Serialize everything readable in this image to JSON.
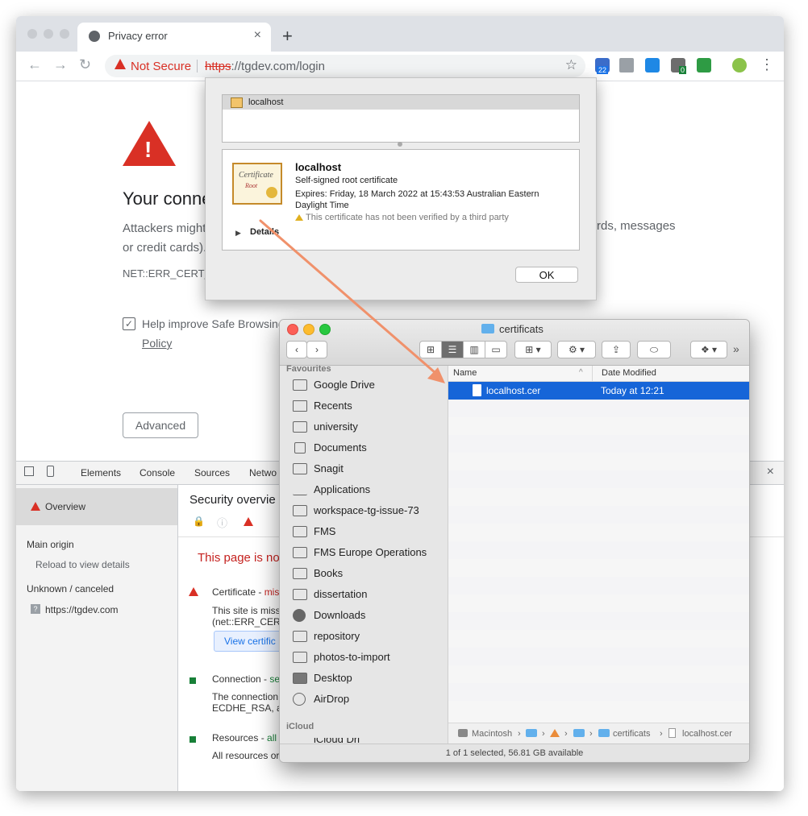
{
  "browser": {
    "tab_title": "Privacy error",
    "tab_close": "×",
    "new_tab": "+",
    "nav_back": "←",
    "nav_forward": "→",
    "nav_reload": "↻",
    "security_label": "Not Secure",
    "url_scheme": "https",
    "url_rest": "://tgdev.com/login",
    "bookmark": "☆",
    "ext_badges": [
      "22",
      "0"
    ],
    "menu": "⋮",
    "icons": [
      "globe-icon",
      "warning-icon",
      "star-icon",
      "extension-icons",
      "profile-icon",
      "kebab-menu-icon"
    ]
  },
  "interstitial": {
    "heading": "Your conne",
    "body_line1": "Attackers might",
    "body_line1_tail": "rds, messages",
    "body_line2": "or credit cards).",
    "error_code": "NET::ERR_CERT_",
    "checkbox_checked": "✓",
    "safe_browsing": "Help improve Safe Browsing",
    "policy": "Policy",
    "advanced": "Advanced"
  },
  "devtools": {
    "tabs": [
      "Elements",
      "Console",
      "Sources",
      "Netwo"
    ],
    "close": "×",
    "sidebar": {
      "overview": "Overview",
      "main_origin": "Main origin",
      "reload": "Reload to view details",
      "unknown": "Unknown / canceled",
      "origin_badge": "?",
      "origin": "https://tgdev.com"
    },
    "main": {
      "title": "Security overvie",
      "lock": "🔒",
      "info": "ⓘ",
      "page_status": "This page is no",
      "cert_label": "Certificate - ",
      "cert_status": "mis",
      "cert_desc1": "This site is miss",
      "cert_desc2": "(net::ERR_CERT",
      "view_cert": "View certific",
      "conn_label": "Connection - ",
      "conn_status": "se",
      "conn_desc1": "The connection",
      "conn_desc2": "ECDHE_RSA, a",
      "res_label": "Resources - ",
      "res_status": "all",
      "res_desc1": "All resources or"
    },
    "colors": {
      "error": "#d93025",
      "secure": "#188038",
      "link": "#1a73e8"
    }
  },
  "cert_sheet": {
    "list_item": "localhost",
    "name": "localhost",
    "kind": "Self-signed root certificate",
    "expires": "Expires: Friday, 18 March 2022 at 15:43:53 Australian Eastern Daylight Time",
    "warning": "This certificate has not been verified by a third party",
    "details": "Details",
    "details_arrow": "▶",
    "ok": "OK",
    "cert_art_title": "Certificate",
    "cert_art_sub": "Root"
  },
  "finder": {
    "title": "certificats",
    "nav_back": "‹",
    "nav_forward": "›",
    "view_icon": "⊞",
    "view_list": "☰",
    "view_columns": "▥",
    "view_gallery": "▭",
    "group": "⊞ ▾",
    "action": "⚙ ▾",
    "share": "⇪",
    "tag": "⬭",
    "dropbox": "❖ ▾",
    "more": "»",
    "favourites_header": "Favourites",
    "icloud_header": "iCloud",
    "icloud_partial": "iCloud Dri",
    "sidebar": [
      "Google Drive",
      "Recents",
      "university",
      "Documents",
      "Snagit",
      "Applications",
      "workspace-tg-issue-73",
      "FMS",
      "FMS Europe Operations",
      "Books",
      "dissertation",
      "Downloads",
      "repository",
      "photos-to-import",
      "Desktop",
      "AirDrop"
    ],
    "col_name": "Name",
    "sort_indicator": "^",
    "col_modified": "Date Modified",
    "file_name": "localhost.cer",
    "file_modified": "Today at 12:21",
    "path": [
      "Macintosh",
      "›",
      "›",
      "›",
      "›",
      "certificats",
      "›",
      "localhost.cer"
    ],
    "status": "1 of 1 selected, 56.81 GB available"
  },
  "annotation": {
    "arrow_color": "#f0916b"
  }
}
